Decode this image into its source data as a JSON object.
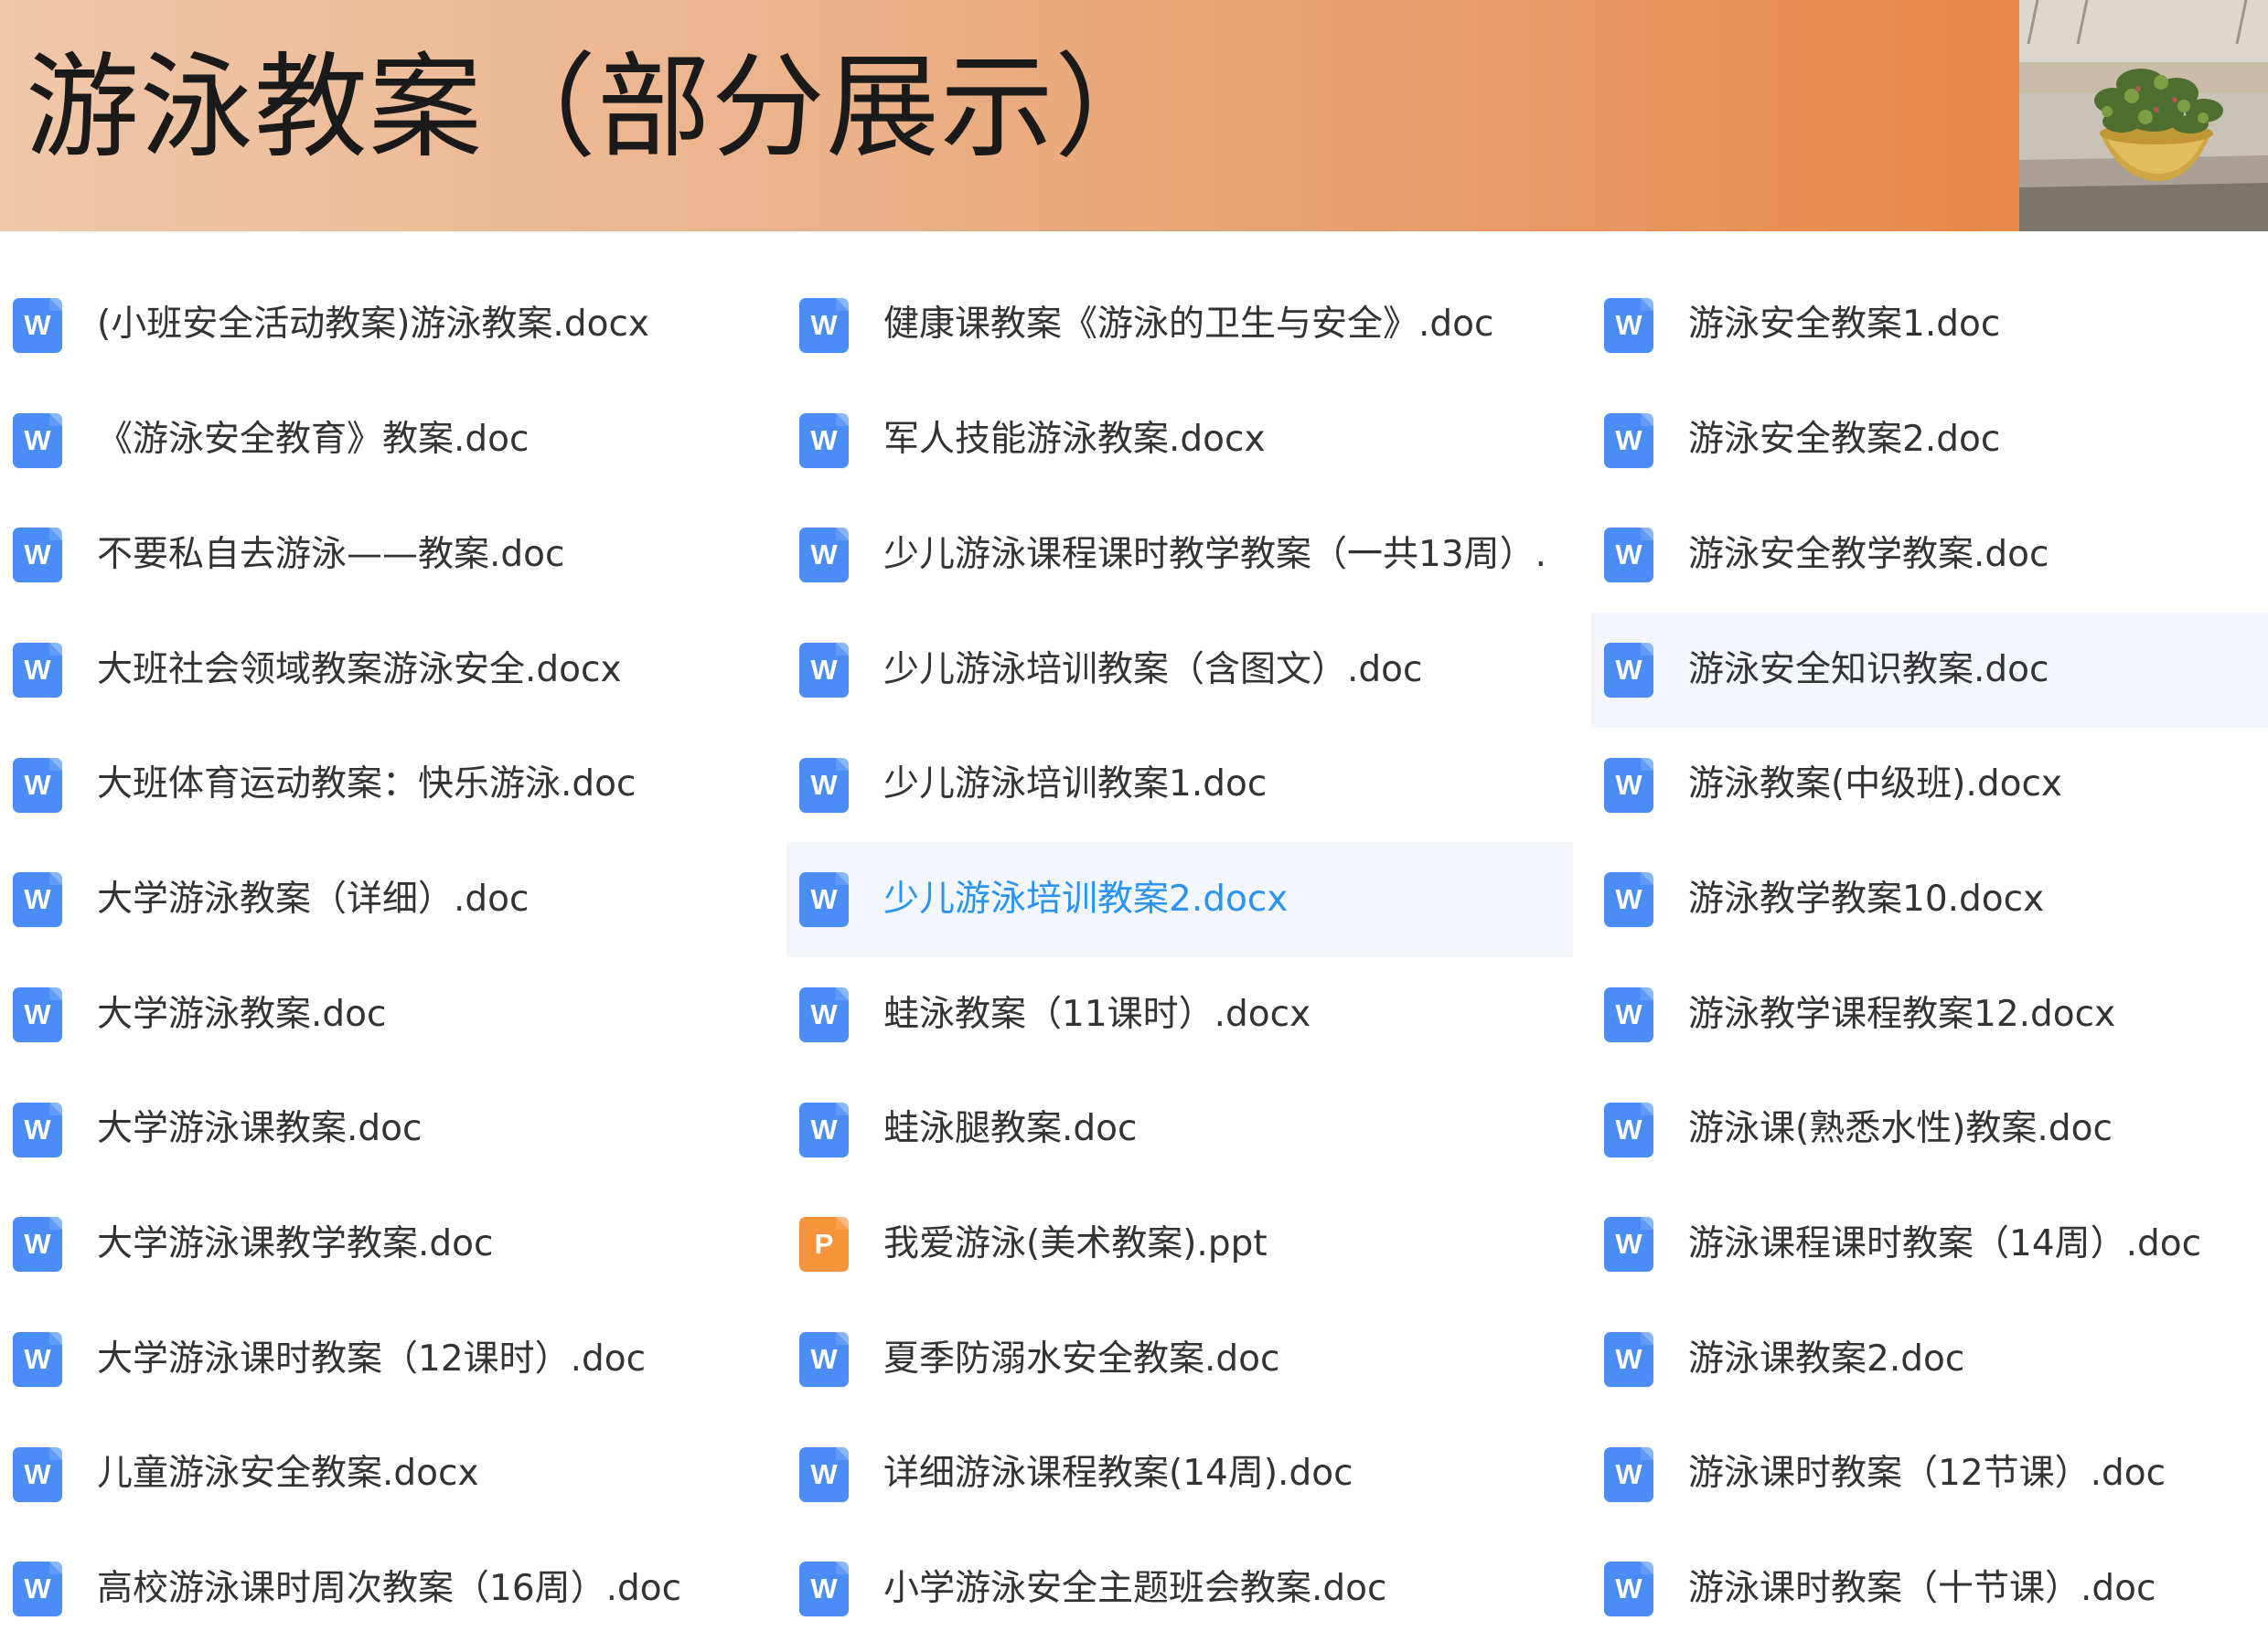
{
  "banner": {
    "title": "游泳教案（部分展示）",
    "photo_label": "盆栽照片"
  },
  "columns": [
    {
      "items": [
        {
          "name": "(小班安全活动教案)游泳教案.docx",
          "type": "W"
        },
        {
          "name": "《游泳安全教育》教案.doc",
          "type": "W"
        },
        {
          "name": "不要私自去游泳——教案.doc",
          "type": "W"
        },
        {
          "name": "大班社会领域教案游泳安全.docx",
          "type": "W"
        },
        {
          "name": "大班体育运动教案：快乐游泳.doc",
          "type": "W"
        },
        {
          "name": "大学游泳教案（详细）.doc",
          "type": "W"
        },
        {
          "name": "大学游泳教案.doc",
          "type": "W"
        },
        {
          "name": "大学游泳课教案.doc",
          "type": "W"
        },
        {
          "name": "大学游泳课教学教案.doc",
          "type": "W"
        },
        {
          "name": "大学游泳课时教案（12课时）.doc",
          "type": "W"
        },
        {
          "name": "儿童游泳安全教案.docx",
          "type": "W"
        },
        {
          "name": "高校游泳课时周次教案（16周）.doc",
          "type": "W"
        }
      ]
    },
    {
      "items": [
        {
          "name": "健康课教案《游泳的卫生与安全》.doc",
          "type": "W"
        },
        {
          "name": "军人技能游泳教案.docx",
          "type": "W"
        },
        {
          "name": "少儿游泳课程课时教学教案（一共13周）.",
          "type": "W"
        },
        {
          "name": "少儿游泳培训教案（含图文）.doc",
          "type": "W"
        },
        {
          "name": "少儿游泳培训教案1.doc",
          "type": "W"
        },
        {
          "name": "少儿游泳培训教案2.docx",
          "type": "W"
        },
        {
          "name": "蛙泳教案（11课时）.docx",
          "type": "W"
        },
        {
          "name": "蛙泳腿教案.doc",
          "type": "W"
        },
        {
          "name": "我爱游泳(美术教案).ppt",
          "type": "P"
        },
        {
          "name": "夏季防溺水安全教案.doc",
          "type": "W"
        },
        {
          "name": "详细游泳课程教案(14周).doc",
          "type": "W"
        },
        {
          "name": "小学游泳安全主题班会教案.doc",
          "type": "W"
        }
      ]
    },
    {
      "items": [
        {
          "name": "游泳安全教案1.doc",
          "type": "W"
        },
        {
          "name": "游泳安全教案2.doc",
          "type": "W"
        },
        {
          "name": "游泳安全教学教案.doc",
          "type": "W"
        },
        {
          "name": "游泳安全知识教案.doc",
          "type": "W"
        },
        {
          "name": "游泳教案(中级班).docx",
          "type": "W"
        },
        {
          "name": "游泳教学教案10.docx",
          "type": "W"
        },
        {
          "name": "游泳教学课程教案12.docx",
          "type": "W"
        },
        {
          "name": "游泳课(熟悉水性)教案.doc",
          "type": "W"
        },
        {
          "name": "游泳课程课时教案（14周）.doc",
          "type": "W"
        },
        {
          "name": "游泳课教案2.doc",
          "type": "W"
        },
        {
          "name": "游泳课时教案（12节课）.doc",
          "type": "W"
        },
        {
          "name": "游泳课时教案（十节课）.doc",
          "type": "W"
        }
      ]
    }
  ],
  "state": {
    "selected": "少儿游泳培训教案2.docx",
    "hovered": "游泳安全知识教案.doc"
  },
  "colors": {
    "word_icon": "#4a8df6",
    "ppt_icon": "#f7933a",
    "selected_text": "#2a94f2",
    "banner_start": "#f0c7a9",
    "banner_end": "#e38a4f"
  }
}
